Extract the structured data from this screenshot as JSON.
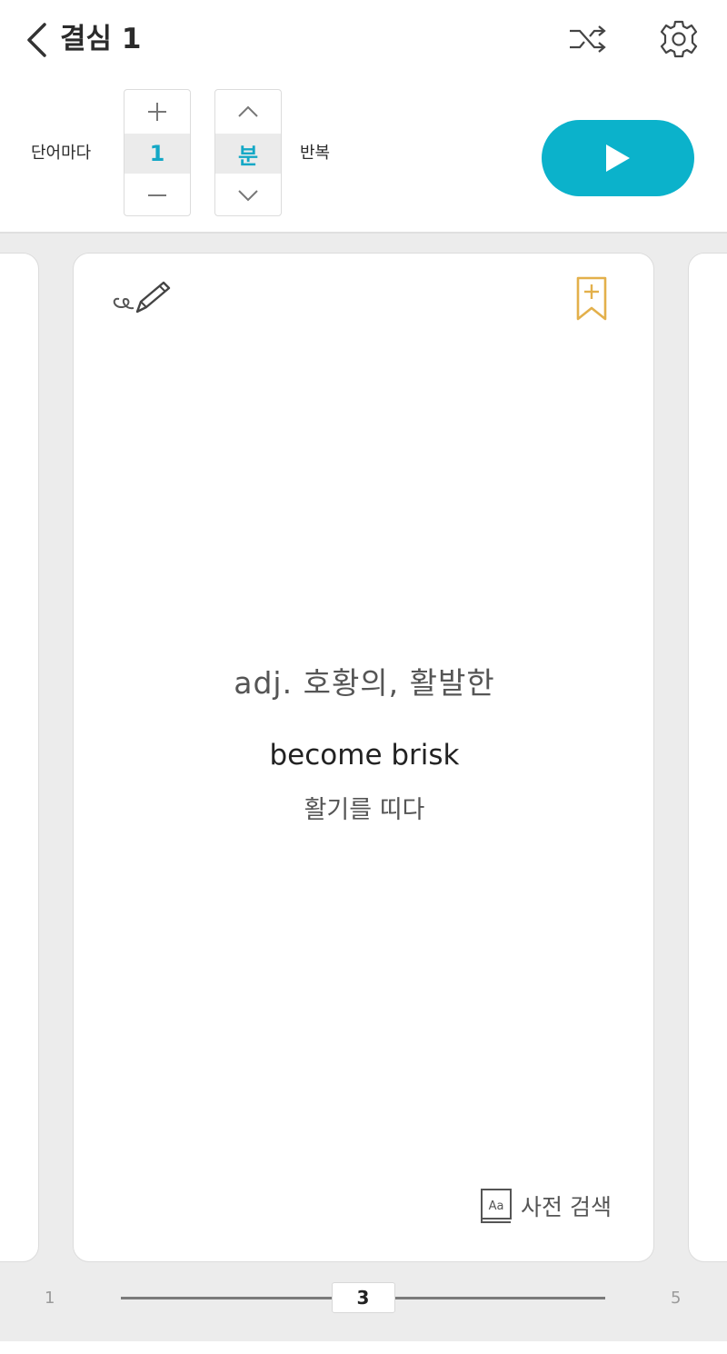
{
  "header": {
    "title": "결심 1",
    "icons": {
      "back": "chevron-left-icon",
      "shuffle": "shuffle-icon",
      "settings": "gear-icon"
    }
  },
  "controls": {
    "per_word_label": "단어마다",
    "count_value": "1",
    "unit_value": "분",
    "repeat_label": "반복",
    "play_icon": "play-icon"
  },
  "card": {
    "meaning": "adj. 호황의, 활발한",
    "phrase": "become brisk",
    "phrase_meaning": "활기를 띠다",
    "dictionary_label": "사전 검색",
    "icons": {
      "memo": "pencil-icon",
      "bookmark": "bookmark-add-icon",
      "dictionary": "dictionary-book-icon"
    }
  },
  "pager": {
    "min": "1",
    "current": "3",
    "max": "5",
    "position_fraction": 0.5
  },
  "colors": {
    "accent": "#0bb2cb",
    "accent_text": "#14a8c6",
    "bookmark": "#e3b04b",
    "background": "#ececec"
  }
}
